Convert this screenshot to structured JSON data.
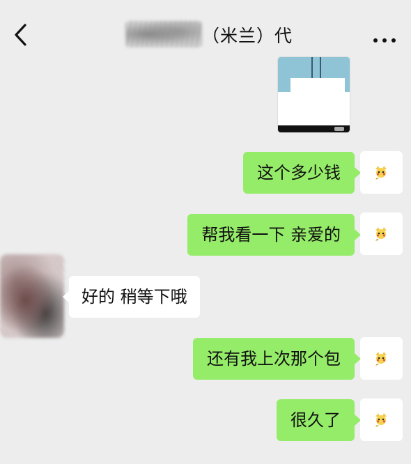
{
  "header": {
    "contact_name_visible": "（米兰）代",
    "back_icon": "back-chevron-icon",
    "more_icon": "more-icon"
  },
  "messages": [
    {
      "side": "right",
      "type": "image"
    },
    {
      "side": "right",
      "type": "text",
      "text": "这个多少钱"
    },
    {
      "side": "right",
      "type": "text",
      "text": "帮我看一下 亲爱的"
    },
    {
      "side": "left",
      "type": "text",
      "text": "好的 稍等下哦"
    },
    {
      "side": "right",
      "type": "text",
      "text": "还有我上次那个包"
    },
    {
      "side": "right",
      "type": "text",
      "text": "很久了"
    }
  ],
  "colors": {
    "background": "#ededed",
    "outgoing_bubble": "#95ec69",
    "incoming_bubble": "#ffffff"
  }
}
